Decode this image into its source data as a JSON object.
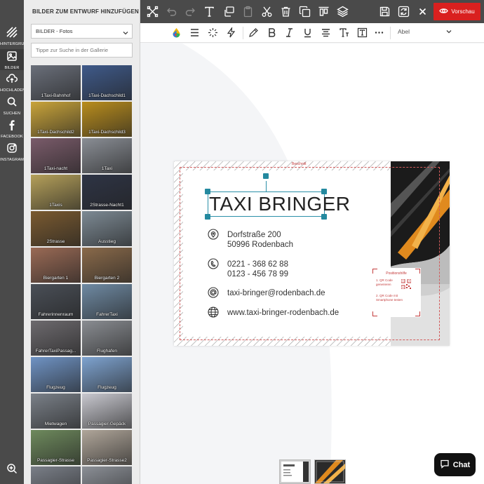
{
  "rail": {
    "items": [
      {
        "label": "HINTERGRUND",
        "icon": "stripes-icon"
      },
      {
        "label": "BILDER",
        "icon": "image-icon"
      },
      {
        "label": "HOCHLADEN",
        "icon": "upload-cloud-icon"
      },
      {
        "label": "SUCHEN",
        "icon": "search-icon"
      },
      {
        "label": "FACEBOOK",
        "icon": "facebook-icon"
      },
      {
        "label": "INSTAGRAM",
        "icon": "instagram-icon"
      }
    ],
    "zoom_icon": "zoom-in-icon"
  },
  "panel": {
    "title": "BILDER ZUM ENTWURF HINZUFÜGEN",
    "select_value": "BILDER - Fotos",
    "search_placeholder": "Tippe zur Suche in der Gallerie",
    "thumbs": [
      {
        "caption": "1Taxi-Bahnhof",
        "bg": "#6a6f7a"
      },
      {
        "caption": "1Taxi-Dachschild1",
        "bg": "#3f5a8a"
      },
      {
        "caption": "1Taxi-Dachschild2",
        "bg": "#c9a43a"
      },
      {
        "caption": "1Taxi-Dachschild3",
        "bg": "#b98d1d"
      },
      {
        "caption": "1Taxi-nacht",
        "bg": "#7a5b6a"
      },
      {
        "caption": "1Taxi",
        "bg": "#8a8e95"
      },
      {
        "caption": "1Taxis",
        "bg": "#b5a05a"
      },
      {
        "caption": "2Strasse-Nacht1",
        "bg": "#2e3445"
      },
      {
        "caption": "2Strasse",
        "bg": "#7a5a30"
      },
      {
        "caption": "Ausstieg",
        "bg": "#7d8a94"
      },
      {
        "caption": "Biergarten 1",
        "bg": "#9a6a55"
      },
      {
        "caption": "Biergarten 2",
        "bg": "#8a6a4a"
      },
      {
        "caption": "Fahrerinnenraum",
        "bg": "#4a4f57"
      },
      {
        "caption": "FahrerTaxi",
        "bg": "#6f8aa3"
      },
      {
        "caption": "FahrerTaxiPassag...",
        "bg": "#6d6a6e"
      },
      {
        "caption": "Flughafen",
        "bg": "#8a8d92"
      },
      {
        "caption": "Flugzeug",
        "bg": "#6f93c4"
      },
      {
        "caption": "Flugzeug",
        "bg": "#7ea3d0"
      },
      {
        "caption": "Mietwagen",
        "bg": "#7a8088"
      },
      {
        "caption": "Passagier-Gepäck",
        "bg": "#c8c8cf"
      },
      {
        "caption": "Passagier-Strasse",
        "bg": "#6e8a5d"
      },
      {
        "caption": "Passagier-Strasse2",
        "bg": "#b0a69a"
      },
      {
        "caption": "",
        "bg": "#7a7f88"
      },
      {
        "caption": "",
        "bg": "#8b8f96"
      }
    ]
  },
  "toolbar": {
    "icons": [
      "group-icon",
      "undo-icon",
      "redo-icon",
      "text-icon",
      "copy-style-icon",
      "paste-icon",
      "cut-icon",
      "delete-icon",
      "duplicate-icon",
      "align-top-icon",
      "layers-icon",
      "save-icon",
      "refresh-icon",
      "close-icon"
    ],
    "preview_label": "Vorschau"
  },
  "format_bar": {
    "icons": [
      "color-icon",
      "line-height-icon",
      "effects-icon",
      "flash-icon",
      "pen-icon",
      "bold-icon",
      "italic-icon",
      "underline-icon",
      "align-icon",
      "text-size-icon",
      "text-box-icon",
      "more-icon"
    ],
    "font_name": "Abel"
  },
  "card": {
    "bleed_label": "Beschnitt",
    "name": "TAXI BRINGER",
    "address_line1": "Dorfstraße 200",
    "address_line2": "50996 Rodenbach",
    "phone1": "0221 - 368 62 88",
    "phone2": "0123 - 456 78 99",
    "email": "taxi-bringer@rodenbach.de",
    "web": "www.taxi-bringer-rodenbach.de",
    "qr_title": "Positionshilfe",
    "qr_line1a": "1. QR Code",
    "qr_line1b": "generieren",
    "qr_line2a": "2. QR Code mit",
    "qr_line2b": "Smartphone testen"
  },
  "chat": {
    "label": "Chat"
  },
  "colors": {
    "accent": "#d9201f",
    "handle": "#24899f",
    "rail": "#4a4a4a"
  }
}
